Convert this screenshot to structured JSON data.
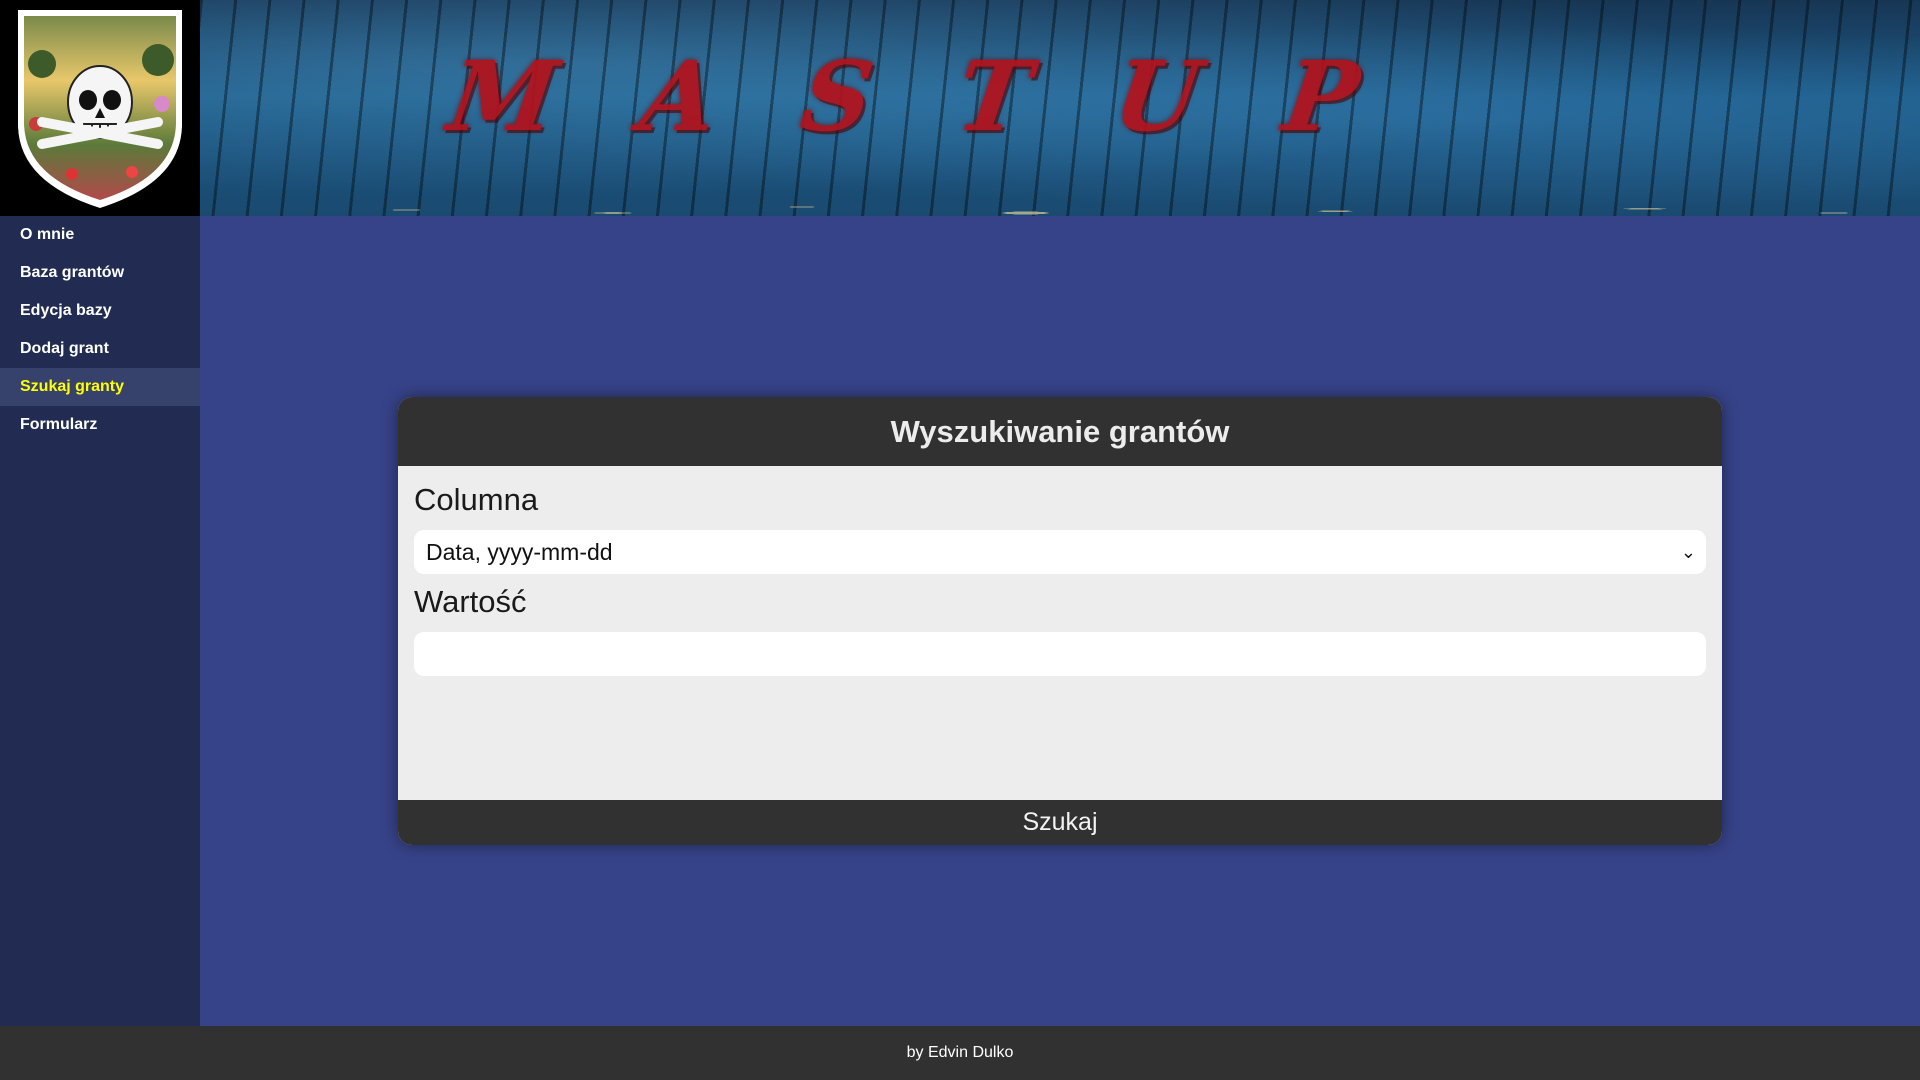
{
  "header": {
    "logo_icon": "skull-shield-logo",
    "banner_text": "MASTUP"
  },
  "sidebar": {
    "items": [
      {
        "label": "O mnie",
        "active": false
      },
      {
        "label": "Baza grantów",
        "active": false
      },
      {
        "label": "Edycja bazy",
        "active": false
      },
      {
        "label": "Dodaj grant",
        "active": false
      },
      {
        "label": "Szukaj granty",
        "active": true
      },
      {
        "label": "Formularz",
        "active": false
      }
    ]
  },
  "search_form": {
    "title": "Wyszukiwanie grantów",
    "column_label": "Columna",
    "column_selected": "Data, yyyy-mm-dd",
    "value_label": "Wartość",
    "value_input": "",
    "submit_label": "Szukaj"
  },
  "footer": {
    "text": "by Edvin Dulko"
  },
  "colors": {
    "page_bg": "#374389",
    "sidebar_bg": "#222c52",
    "active_nav_text": "#ffff00",
    "card_bar": "#313131",
    "card_body": "#ededed"
  }
}
